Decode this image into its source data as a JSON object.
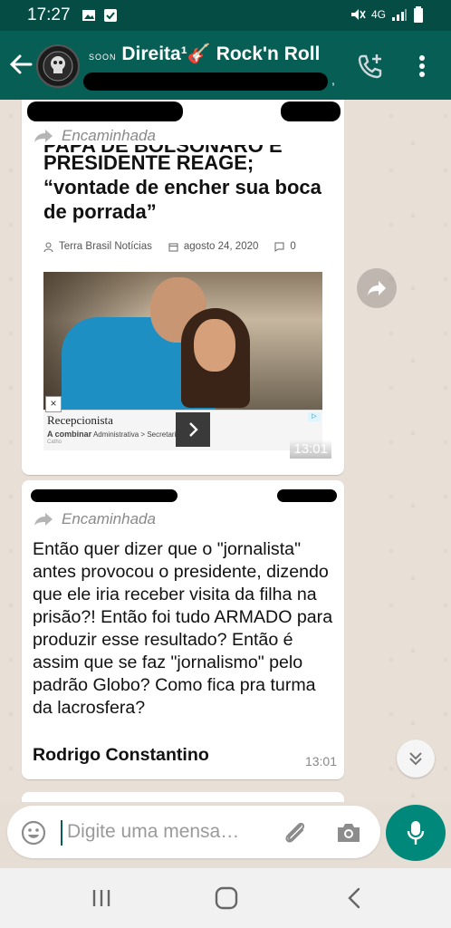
{
  "status_bar": {
    "time": "17:27",
    "network": "4G",
    "icons": [
      "image-icon",
      "checkbox-icon",
      "mute-icon",
      "signal-icon",
      "battery-icon"
    ]
  },
  "header": {
    "group_prefix": "SOON",
    "group_name": "Direita¹🎸 Rock'n Roll",
    "members_tail": ",",
    "icons": [
      "back-arrow-icon",
      "add-call-icon",
      "more-vert-icon"
    ]
  },
  "messages": [
    {
      "forwarded_label": "Encaminhada",
      "article": {
        "headline_cut": "PAPA DE BOLSONARO E",
        "headline": "PRESIDENTE REAGE;\n“vontade de encher sua boca\nde porrada”",
        "source": "Terra Brasil Notícias",
        "date": "agosto 24, 2020",
        "comments": "0"
      },
      "ad": {
        "close": "×",
        "title": "Recepcionista",
        "subtitle_bold": "A combinar",
        "subtitle": "Administrativa > Secretariado",
        "brand": "Catho"
      },
      "time": "13:01"
    },
    {
      "forwarded_label": "Encaminhada",
      "text": "Então quer dizer que o \"jornalista\" antes provocou o presidente, dizendo que ele iria receber visita da filha na prisão?! Então foi tudo ARMADO para produzir esse resultado? Então é assim que se faz \"jornalismo\" pelo padrão Globo? Como fica pra turma da lacrosfera?",
      "signature": "Rodrigo Constantino",
      "time": "13:01"
    }
  ],
  "composer": {
    "placeholder": "Digite uma mensa…"
  },
  "colors": {
    "header": "#075e54",
    "status_bar": "#054d44",
    "mic_button": "#00897b",
    "chat_background": "#e8dfd6"
  }
}
